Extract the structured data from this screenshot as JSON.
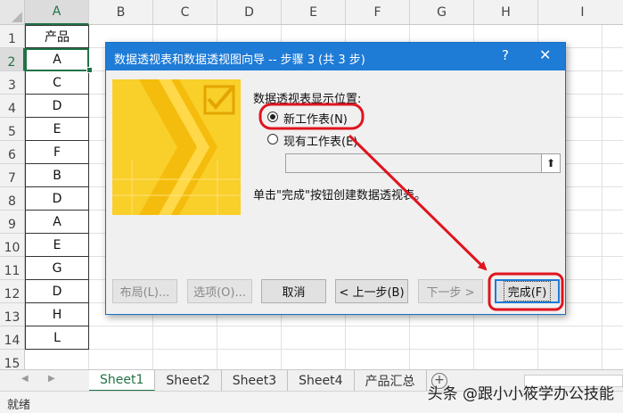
{
  "sheet": {
    "columns": [
      "A",
      "B",
      "C",
      "D",
      "E",
      "F",
      "G",
      "H",
      "I"
    ],
    "rows": [
      "1",
      "2",
      "3",
      "4",
      "5",
      "6",
      "7",
      "8",
      "9",
      "10",
      "11",
      "12",
      "13",
      "14",
      "15"
    ],
    "colA": [
      "产品",
      "A",
      "C",
      "D",
      "E",
      "F",
      "B",
      "D",
      "A",
      "E",
      "G",
      "D",
      "H",
      "L"
    ]
  },
  "dialog": {
    "title": "数据透视表和数据透视图向导 -- 步骤 3 (共 3 步)",
    "help": "?",
    "close": "✕",
    "location_label": "数据透视表显示位置:",
    "option_new": "新工作表(N)",
    "option_existing": "现有工作表(E)",
    "range_value": "",
    "range_button": "⬆",
    "hint": "单击\"完成\"按钮创建数据透视表。",
    "buttons": {
      "layout": "布局(L)...",
      "options": "选项(O)...",
      "cancel": "取消",
      "back": "< 上一步(B)",
      "next": "下一步 >",
      "finish": "完成(F)"
    }
  },
  "tabs": [
    "Sheet1",
    "Sheet2",
    "Sheet3",
    "Sheet4",
    "产品汇总"
  ],
  "active_tab": "Sheet1",
  "statusbar": {
    "status": "就绪",
    "watermark": "头条 @跟小小筱学办公技能"
  },
  "colors": {
    "excel_green": "#217346",
    "dialog_blue": "#1e7bd6",
    "annotation_red": "#e0141e"
  }
}
